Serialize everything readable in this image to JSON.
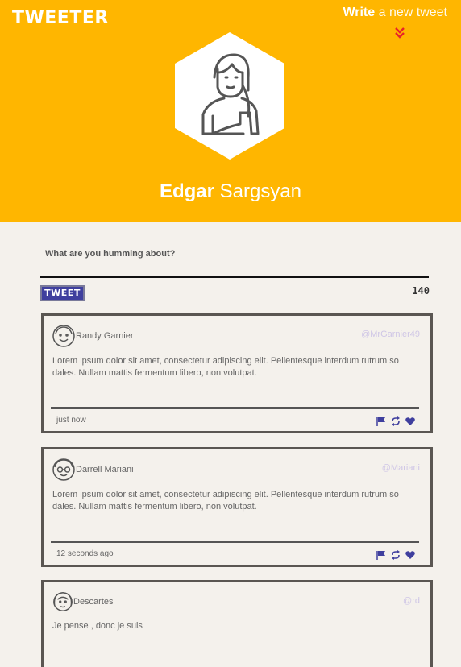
{
  "header": {
    "logo": "TWEETER",
    "write_bold": "Write",
    "write_rest": "a new tweet",
    "user_first": "Edgar",
    "user_last": "Sargsyan",
    "bg_color": "#ffb600"
  },
  "compose": {
    "label": "What are you humming about?",
    "button": "TWEET",
    "char_count": "140",
    "button_color": "#3f3f9e"
  },
  "tweets": [
    {
      "name": "Randy Garnier",
      "handle": "@MrGarnier49",
      "text": "Lorem ipsum dolor sit amet, consectetur adipiscing elit. Pellentesque interdum rutrum so dales. Nullam mattis fermentum libero, non volutpat.",
      "time": "just now"
    },
    {
      "name": "Darrell Mariani",
      "handle": "@Mariani",
      "text": "Lorem ipsum dolor sit amet, consectetur adipiscing elit. Pellentesque interdum rutrum so dales. Nullam mattis fermentum libero, non volutpat.",
      "time": "12 seconds ago"
    },
    {
      "name": "Descartes",
      "handle": "@rd",
      "text": "Je pense , donc je suis",
      "time": ""
    }
  ],
  "icons": {
    "flag": "flag-icon",
    "retweet": "retweet-icon",
    "like": "heart-icon",
    "action_color": "#3f3f9e"
  }
}
